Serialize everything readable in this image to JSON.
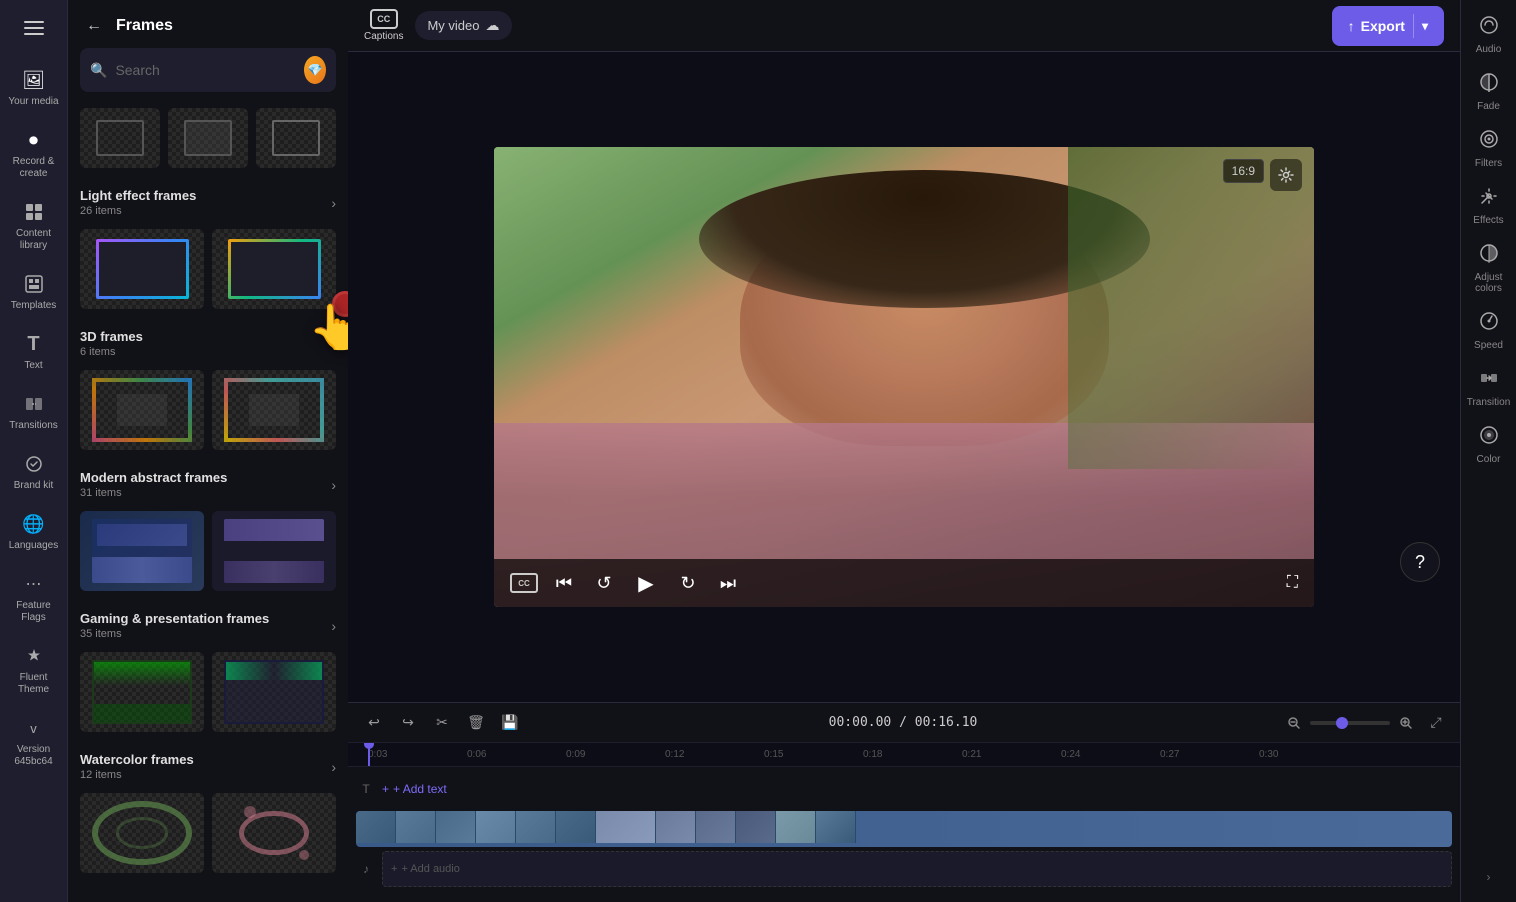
{
  "app": {
    "title": "My video"
  },
  "sidebar": {
    "items": [
      {
        "id": "your-media",
        "label": "Your media",
        "icon": "🖼"
      },
      {
        "id": "record",
        "label": "Record &\ncreate",
        "icon": "⏺"
      },
      {
        "id": "content-library",
        "label": "Content library",
        "icon": "📚"
      },
      {
        "id": "templates",
        "label": "Templates",
        "icon": "⊞"
      },
      {
        "id": "text",
        "label": "Text",
        "icon": "T"
      },
      {
        "id": "transitions",
        "label": "Transitions",
        "icon": "⟷"
      },
      {
        "id": "brand-kit",
        "label": "Brand kit",
        "icon": "✦"
      },
      {
        "id": "languages",
        "label": "Languages",
        "icon": "🌐"
      },
      {
        "id": "feature-flags",
        "label": "Feature Flags",
        "icon": "⋯"
      },
      {
        "id": "fluent-theme",
        "label": "Fluent Theme",
        "icon": "◈"
      },
      {
        "id": "version",
        "label": "Version\n645bc64",
        "icon": "⚙"
      }
    ]
  },
  "frames_panel": {
    "title": "Frames",
    "search_placeholder": "Search",
    "sections": [
      {
        "id": "light-effect-frames",
        "title": "Light effect frames",
        "count": "26 items"
      },
      {
        "id": "3d-frames",
        "title": "3D frames",
        "count": "6 items"
      },
      {
        "id": "modern-abstract-frames",
        "title": "Modern abstract frames",
        "count": "31 items"
      },
      {
        "id": "gaming-presentation-frames",
        "title": "Gaming & presentation frames",
        "count": "35 items"
      },
      {
        "id": "watercolor-frames",
        "title": "Watercolor frames",
        "count": "12 items"
      }
    ]
  },
  "topbar": {
    "video_title": "My video",
    "export_label": "Export",
    "captions_label": "Captions"
  },
  "right_panel": {
    "tools": [
      {
        "id": "audio",
        "label": "Audio",
        "icon": "🔊"
      },
      {
        "id": "fade",
        "label": "Fade",
        "icon": "◐"
      },
      {
        "id": "filters",
        "label": "Filters",
        "icon": "⊕"
      },
      {
        "id": "effects",
        "label": "Effects",
        "icon": "✏"
      },
      {
        "id": "adjust-colors",
        "label": "Adjust colors",
        "icon": "◑"
      },
      {
        "id": "speed",
        "label": "Speed",
        "icon": "⊙"
      },
      {
        "id": "transition",
        "label": "Transition",
        "icon": "▶"
      },
      {
        "id": "color",
        "label": "Color",
        "icon": "◉"
      }
    ]
  },
  "timeline": {
    "current_time": "00:00.00",
    "total_time": "00:16.10",
    "aspect_ratio": "16:9",
    "ruler_marks": [
      "0:03",
      "0:06",
      "0:09",
      "0:12",
      "0:15",
      "0:18",
      "0:21",
      "0:24",
      "0:27",
      "0:30"
    ],
    "add_text_label": "+ Add text",
    "add_audio_label": "+ Add audio"
  }
}
